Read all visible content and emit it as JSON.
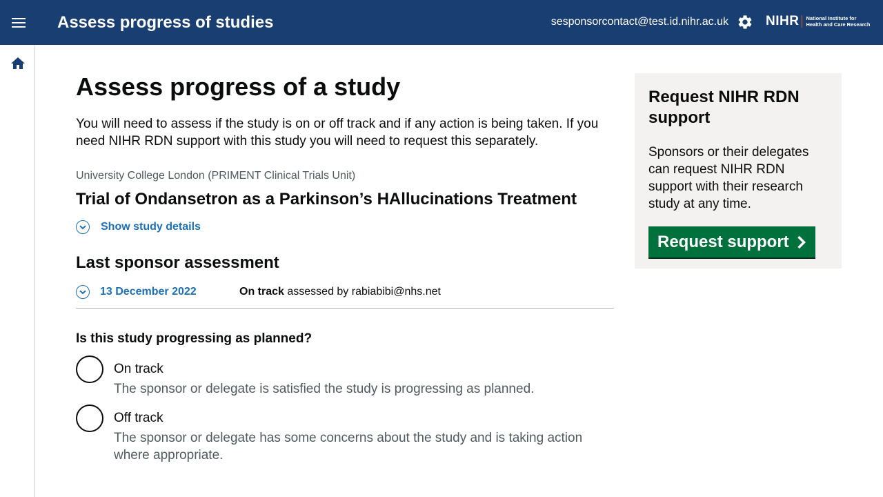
{
  "header": {
    "title": "Assess progress of studies",
    "user_email": "sesponsorcontact@test.id.nihr.ac.uk",
    "logo": {
      "mark": "NIHR",
      "line1": "National Institute for",
      "line2": "Health and Care Research"
    }
  },
  "icons": {
    "menu": "menu-icon",
    "settings": "gear-icon",
    "home": "home-icon",
    "chevron": "chevron-down-icon",
    "arrow": "chevron-right-icon"
  },
  "colors": {
    "header_bg": "#193e72",
    "link": "#1d70b8",
    "button": "#00703c",
    "panel": "#f3f2f1"
  },
  "main": {
    "page_title": "Assess progress of a study",
    "lead": "You will need to assess if the study is on or off track and if any action is being taken. If you need NIHR RDN support with this study you will need to request this separately.",
    "organisation": "University College London (PRIMENT Clinical Trials Unit)",
    "study_title": "Trial of Ondansetron as a Parkinson’s HAllucinations Treatment",
    "show_details_label": "Show study details",
    "last_assessment_heading": "Last sponsor assessment",
    "last_assessment": {
      "date": "13 December 2022",
      "status": "On track",
      "assessed_by_text": " assessed by rabiabibi@nhs.net"
    },
    "question": "Is this study progressing as planned?",
    "options": [
      {
        "label": "On track",
        "hint": "The sponsor or delegate is satisfied the study is progressing as planned."
      },
      {
        "label": "Off track",
        "hint": "The sponsor or delegate has some concerns about the study and is taking action where appropriate."
      }
    ]
  },
  "aside": {
    "title": "Request NIHR RDN support",
    "text": "Sponsors or their delegates can request NIHR RDN support with their research study at any time.",
    "button_label": "Request support"
  }
}
